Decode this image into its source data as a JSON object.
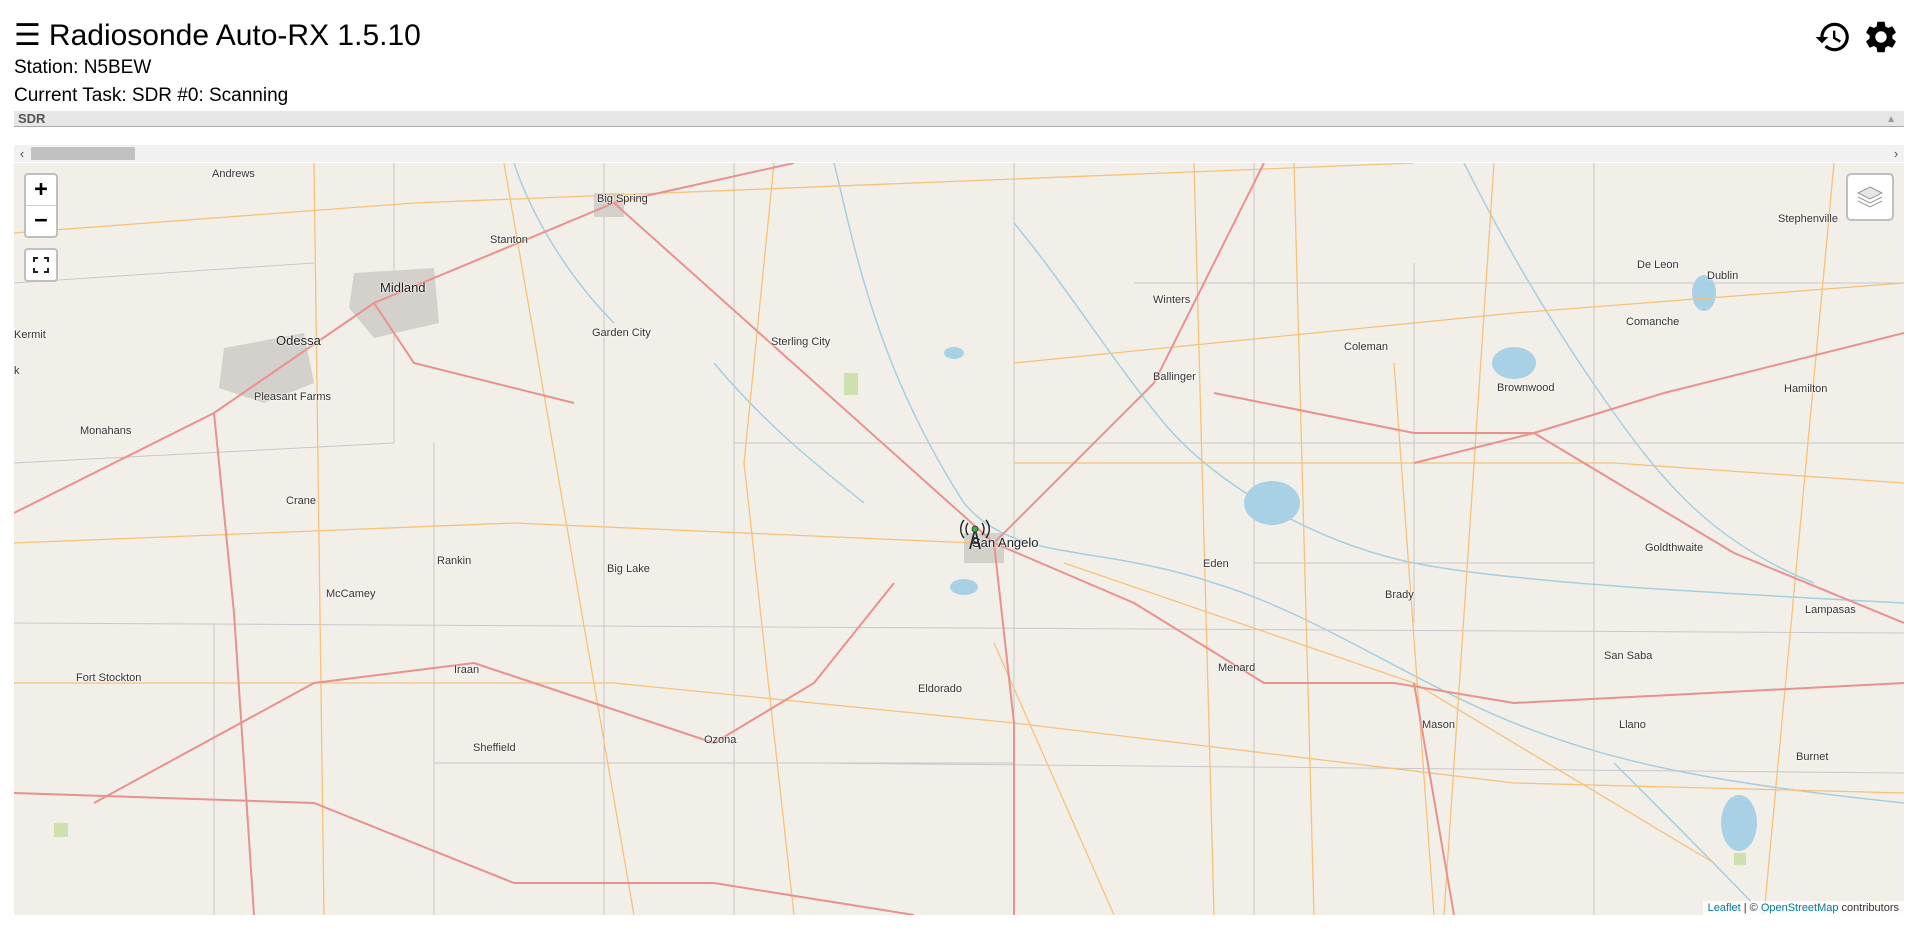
{
  "header": {
    "menu_icon": "☰",
    "title": "Radiosonde Auto-RX 1.5.10",
    "station": "Station: N5BEW",
    "current_task": "Current Task: SDR #0: Scanning",
    "icons": [
      "history-icon",
      "gear-icon"
    ]
  },
  "sdr_panel": {
    "label": "SDR",
    "collapse_icon": "caret-up-icon"
  },
  "scrollbar": {
    "left_arrow": "‹",
    "right_arrow": "›"
  },
  "map": {
    "zoom_in": "+",
    "zoom_out": "−",
    "controls": [
      "zoom-in-button",
      "zoom-out-button",
      "fullscreen-button",
      "layers-button"
    ],
    "marker": "station-antenna-icon",
    "cities": {
      "andrews": "Andrews",
      "big_spring": "Big Spring",
      "stanton": "Stanton",
      "midland": "Midland",
      "odessa": "Odessa",
      "kermit": "Kermit",
      "k": "k",
      "garden_city": "Garden City",
      "sterling_city": "Sterling City",
      "pleasant_farms": "Pleasant Farms",
      "monahans": "Monahans",
      "crane": "Crane",
      "rankin": "Rankin",
      "big_lake": "Big Lake",
      "mccamey": "McCamey",
      "fort_stockton": "Fort Stockton",
      "iraan": "Iraan",
      "sheffield": "Sheffield",
      "ozona": "Ozona",
      "eldorado": "Eldorado",
      "san_angelo": "San Angelo",
      "winters": "Winters",
      "ballinger": "Ballinger",
      "coleman": "Coleman",
      "eden": "Eden",
      "menard": "Menard",
      "brady": "Brady",
      "mason": "Mason",
      "llano": "Llano",
      "brownwood": "Brownwood",
      "comanche": "Comanche",
      "de_leon": "De Leon",
      "dublin": "Dublin",
      "stephenville": "Stephenville",
      "hamilton": "Hamilton",
      "goldthwaite": "Goldthwaite",
      "san_saba": "San Saba",
      "lampasas": "Lampasas",
      "burnet": "Burnet"
    },
    "attribution": {
      "leaflet": "Leaflet",
      "separator": " | © ",
      "osm": "OpenStreetMap",
      "suffix": " contributors"
    }
  },
  "colors": {
    "map_background": "#f2efe9",
    "highway": "#e8928f",
    "road": "#f6c27a",
    "county_line": "#c9c2c9",
    "river": "#a5cfe0",
    "lake": "#a9d1e6"
  }
}
